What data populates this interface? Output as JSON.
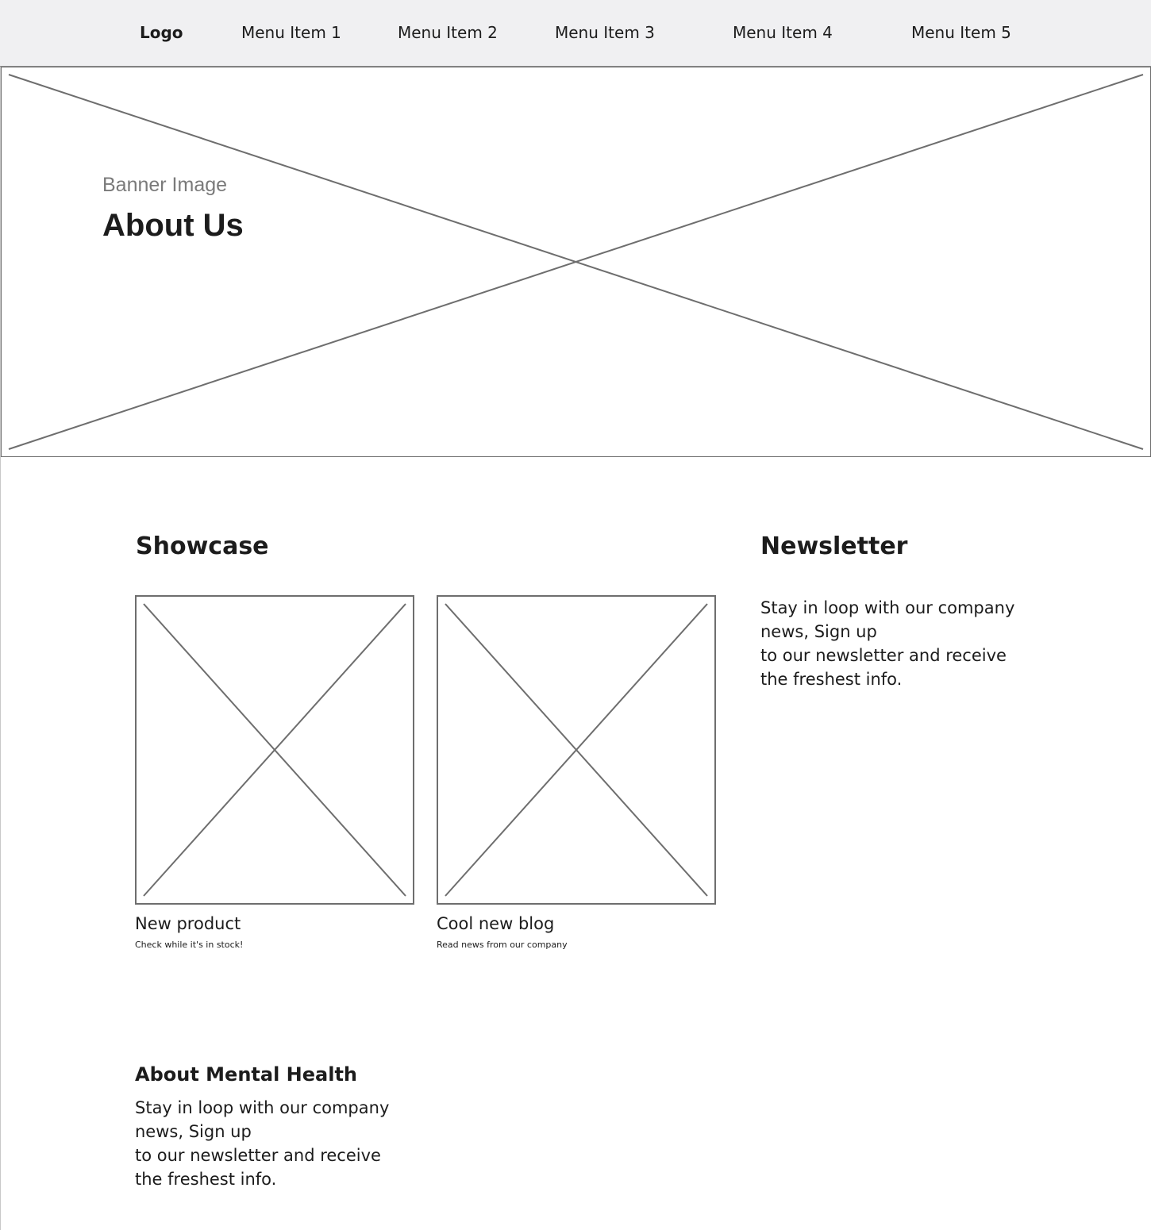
{
  "nav": {
    "logo": "Logo",
    "items": [
      "Menu Item 1",
      "Menu Item 2",
      "Menu Item 3",
      "Menu Item 4",
      "Menu Item 5"
    ]
  },
  "banner": {
    "caption": "Banner Image",
    "title": "About Us"
  },
  "showcase": {
    "heading": "Showcase",
    "cards": [
      {
        "title": "New product",
        "subtitle": "Check while it's in stock!"
      },
      {
        "title": "Cool new blog",
        "subtitle": "Read news from our company"
      }
    ]
  },
  "newsletter": {
    "heading": "Newsletter",
    "lines": [
      "Stay in loop with our company",
      "news, Sign up",
      "to our newsletter and receive",
      "the freshest info."
    ]
  },
  "about_mental_health": {
    "heading": "About Mental Health",
    "lines": [
      "Stay in loop with our company",
      "news, Sign up",
      "to our newsletter and receive",
      "the freshest info."
    ]
  },
  "colors": {
    "nav_background": "#f0f0f2",
    "placeholder_stroke": "#6e6e6e",
    "caption_text": "#7a7a7a",
    "text": "#1c1c1c"
  }
}
